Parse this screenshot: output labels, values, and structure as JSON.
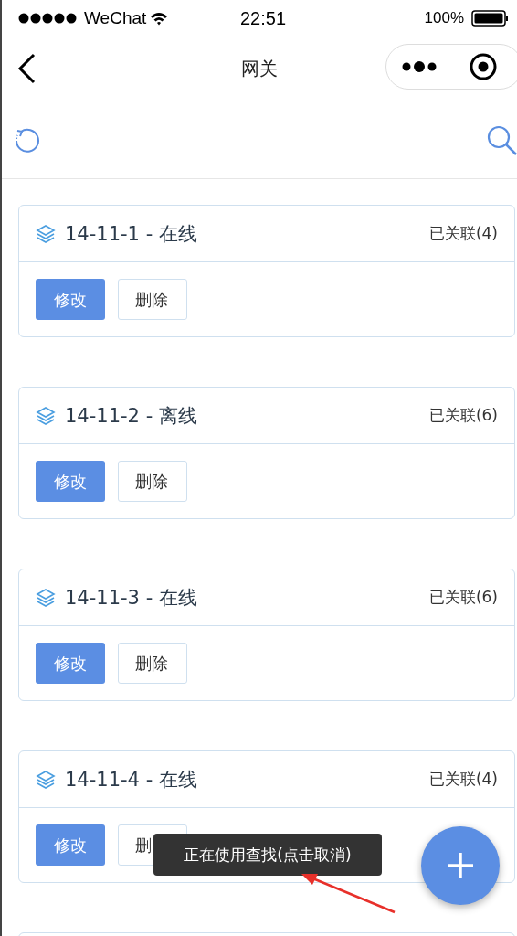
{
  "status_bar": {
    "carrier": "WeChat",
    "time": "22:51",
    "battery": "100%"
  },
  "nav": {
    "title": "网关"
  },
  "gateways": [
    {
      "name": "14-11-1 - 在线",
      "linked": "已关联(4)",
      "edit": "修改",
      "delete": "删除"
    },
    {
      "name": "14-11-2 - 离线",
      "linked": "已关联(6)",
      "edit": "修改",
      "delete": "删除"
    },
    {
      "name": "14-11-3 - 在线",
      "linked": "已关联(6)",
      "edit": "修改",
      "delete": "删除"
    },
    {
      "name": "14-11-4 - 在线",
      "linked": "已关联(4)",
      "edit": "修改",
      "delete": "删"
    }
  ],
  "toast": "正在使用查找(点击取消)"
}
